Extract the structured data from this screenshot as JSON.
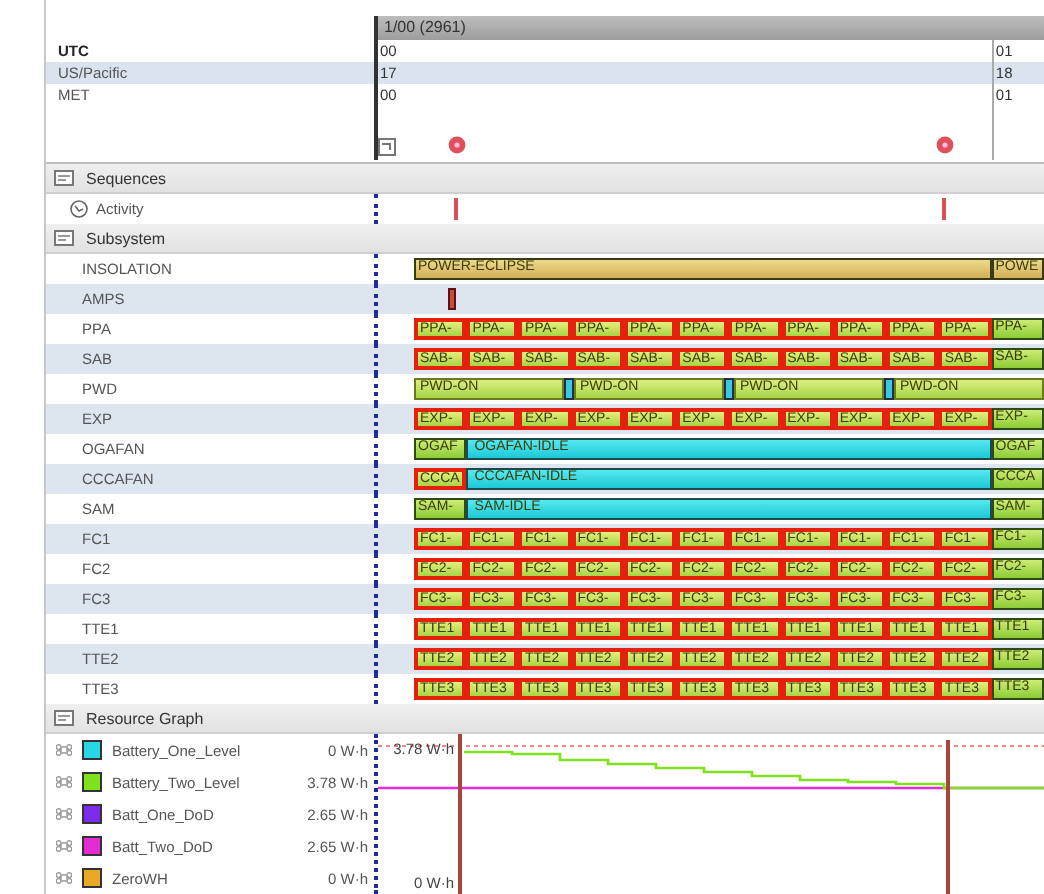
{
  "timeline": {
    "title": "1/00 (2961)",
    "zones": [
      {
        "name": "UTC",
        "primary": true,
        "selected": false,
        "start": "00",
        "end": "01"
      },
      {
        "name": "US/Pacific",
        "primary": false,
        "selected": true,
        "start": "17",
        "end": "18"
      },
      {
        "name": "MET",
        "primary": false,
        "selected": false,
        "start": "00",
        "end": "01"
      }
    ]
  },
  "sequences": {
    "title": "Sequences",
    "items": [
      {
        "name": "Activity"
      }
    ]
  },
  "subsystem": {
    "title": "Subsystem",
    "rows": [
      {
        "name": "INSOLATION",
        "segments": [
          {
            "label": "POWER-ECLIPSE",
            "kind": "eclipse"
          },
          {
            "label": "POWE",
            "kind": "edge"
          }
        ]
      },
      {
        "name": "AMPS",
        "segments": [
          {
            "kind": "spike"
          }
        ]
      },
      {
        "name": "PPA",
        "segments": [
          {
            "label": "PPA-",
            "kind": "active"
          },
          {
            "label": "PPA-",
            "kind": "active"
          },
          {
            "label": "PPA-",
            "kind": "active"
          },
          {
            "label": "PPA-",
            "kind": "active"
          },
          {
            "label": "PPA-",
            "kind": "active"
          },
          {
            "label": "PPA-",
            "kind": "active"
          },
          {
            "label": "PPA-",
            "kind": "active"
          },
          {
            "label": "PPA-",
            "kind": "active"
          },
          {
            "label": "PPA-",
            "kind": "active"
          },
          {
            "label": "PPA-",
            "kind": "active"
          },
          {
            "label": "PPA-",
            "kind": "active"
          },
          {
            "label": "PPA-",
            "kind": "plain"
          }
        ]
      },
      {
        "name": "SAB",
        "segments": [
          {
            "label": "SAB-",
            "kind": "active"
          },
          {
            "label": "SAB-",
            "kind": "active"
          },
          {
            "label": "SAB-",
            "kind": "active"
          },
          {
            "label": "SAB-",
            "kind": "active"
          },
          {
            "label": "SAB-",
            "kind": "active"
          },
          {
            "label": "SAB-",
            "kind": "active"
          },
          {
            "label": "SAB-",
            "kind": "active"
          },
          {
            "label": "SAB-",
            "kind": "active"
          },
          {
            "label": "SAB-",
            "kind": "active"
          },
          {
            "label": "SAB-",
            "kind": "active"
          },
          {
            "label": "SAB-",
            "kind": "active"
          },
          {
            "label": "SAB-",
            "kind": "plain"
          }
        ]
      },
      {
        "name": "PWD",
        "segments": [
          {
            "label": "PWD-ON",
            "kind": "on"
          },
          {
            "kind": "switch"
          },
          {
            "label": "PWD-ON",
            "kind": "on"
          },
          {
            "kind": "switch"
          },
          {
            "label": "PWD-ON",
            "kind": "on"
          },
          {
            "kind": "switch"
          },
          {
            "label": "PWD-ON",
            "kind": "on"
          }
        ]
      },
      {
        "name": "EXP",
        "segments": [
          {
            "label": "EXP-",
            "kind": "active"
          },
          {
            "label": "EXP-",
            "kind": "active"
          },
          {
            "label": "EXP-",
            "kind": "active"
          },
          {
            "label": "EXP-",
            "kind": "active"
          },
          {
            "label": "EXP-",
            "kind": "active"
          },
          {
            "label": "EXP-",
            "kind": "active"
          },
          {
            "label": "EXP-",
            "kind": "active"
          },
          {
            "label": "EXP-",
            "kind": "active"
          },
          {
            "label": "EXP-",
            "kind": "active"
          },
          {
            "label": "EXP-",
            "kind": "active"
          },
          {
            "label": "EXP-",
            "kind": "active"
          },
          {
            "label": "EXP-",
            "kind": "plain"
          }
        ]
      },
      {
        "name": "OGAFAN",
        "segments": [
          {
            "label": "OGAF",
            "kind": "plain"
          },
          {
            "label": "OGAFAN-IDLE",
            "kind": "idle"
          },
          {
            "label": "OGAF",
            "kind": "plain"
          }
        ]
      },
      {
        "name": "CCCAFAN",
        "segments": [
          {
            "label": "CCCA",
            "kind": "active"
          },
          {
            "label": "CCCAFAN-IDLE",
            "kind": "idle"
          },
          {
            "label": "CCCA",
            "kind": "plain"
          }
        ]
      },
      {
        "name": "SAM",
        "segments": [
          {
            "label": "SAM-",
            "kind": "plain"
          },
          {
            "label": "SAM-IDLE",
            "kind": "idle"
          },
          {
            "label": "SAM-",
            "kind": "plain"
          }
        ]
      },
      {
        "name": "FC1",
        "segments": [
          {
            "label": "FC1-",
            "kind": "active"
          },
          {
            "label": "FC1-",
            "kind": "active"
          },
          {
            "label": "FC1-",
            "kind": "active"
          },
          {
            "label": "FC1-",
            "kind": "active"
          },
          {
            "label": "FC1-",
            "kind": "active"
          },
          {
            "label": "FC1-",
            "kind": "active"
          },
          {
            "label": "FC1-",
            "kind": "active"
          },
          {
            "label": "FC1-",
            "kind": "active"
          },
          {
            "label": "FC1-",
            "kind": "active"
          },
          {
            "label": "FC1-",
            "kind": "active"
          },
          {
            "label": "FC1-",
            "kind": "active"
          },
          {
            "label": "FC1-",
            "kind": "plain"
          }
        ]
      },
      {
        "name": "FC2",
        "segments": [
          {
            "label": "FC2-",
            "kind": "active"
          },
          {
            "label": "FC2-",
            "kind": "active"
          },
          {
            "label": "FC2-",
            "kind": "active"
          },
          {
            "label": "FC2-",
            "kind": "active"
          },
          {
            "label": "FC2-",
            "kind": "active"
          },
          {
            "label": "FC2-",
            "kind": "active"
          },
          {
            "label": "FC2-",
            "kind": "active"
          },
          {
            "label": "FC2-",
            "kind": "active"
          },
          {
            "label": "FC2-",
            "kind": "active"
          },
          {
            "label": "FC2-",
            "kind": "active"
          },
          {
            "label": "FC2-",
            "kind": "active"
          },
          {
            "label": "FC2-",
            "kind": "plain"
          }
        ]
      },
      {
        "name": "FC3",
        "segments": [
          {
            "label": "FC3-",
            "kind": "active"
          },
          {
            "label": "FC3-",
            "kind": "active"
          },
          {
            "label": "FC3-",
            "kind": "active"
          },
          {
            "label": "FC3-",
            "kind": "active"
          },
          {
            "label": "FC3-",
            "kind": "active"
          },
          {
            "label": "FC3-",
            "kind": "active"
          },
          {
            "label": "FC3-",
            "kind": "active"
          },
          {
            "label": "FC3-",
            "kind": "active"
          },
          {
            "label": "FC3-",
            "kind": "active"
          },
          {
            "label": "FC3-",
            "kind": "active"
          },
          {
            "label": "FC3-",
            "kind": "active"
          },
          {
            "label": "FC3-",
            "kind": "plain"
          }
        ]
      },
      {
        "name": "TTE1",
        "segments": [
          {
            "label": "TTE1",
            "kind": "active"
          },
          {
            "label": "TTE1",
            "kind": "active"
          },
          {
            "label": "TTE1",
            "kind": "active"
          },
          {
            "label": "TTE1",
            "kind": "active"
          },
          {
            "label": "TTE1",
            "kind": "active"
          },
          {
            "label": "TTE1",
            "kind": "active"
          },
          {
            "label": "TTE1",
            "kind": "active"
          },
          {
            "label": "TTE1",
            "kind": "active"
          },
          {
            "label": "TTE1",
            "kind": "active"
          },
          {
            "label": "TTE1",
            "kind": "active"
          },
          {
            "label": "TTE1",
            "kind": "active"
          },
          {
            "label": "TTE1",
            "kind": "plain"
          }
        ]
      },
      {
        "name": "TTE2",
        "segments": [
          {
            "label": "TTE2",
            "kind": "active"
          },
          {
            "label": "TTE2",
            "kind": "active"
          },
          {
            "label": "TTE2",
            "kind": "active"
          },
          {
            "label": "TTE2",
            "kind": "active"
          },
          {
            "label": "TTE2",
            "kind": "active"
          },
          {
            "label": "TTE2",
            "kind": "active"
          },
          {
            "label": "TTE2",
            "kind": "active"
          },
          {
            "label": "TTE2",
            "kind": "active"
          },
          {
            "label": "TTE2",
            "kind": "active"
          },
          {
            "label": "TTE2",
            "kind": "active"
          },
          {
            "label": "TTE2",
            "kind": "active"
          },
          {
            "label": "TTE2",
            "kind": "plain"
          }
        ]
      },
      {
        "name": "TTE3",
        "segments": [
          {
            "label": "TTE3",
            "kind": "active"
          },
          {
            "label": "TTE3",
            "kind": "active"
          },
          {
            "label": "TTE3",
            "kind": "active"
          },
          {
            "label": "TTE3",
            "kind": "active"
          },
          {
            "label": "TTE3",
            "kind": "active"
          },
          {
            "label": "TTE3",
            "kind": "active"
          },
          {
            "label": "TTE3",
            "kind": "active"
          },
          {
            "label": "TTE3",
            "kind": "active"
          },
          {
            "label": "TTE3",
            "kind": "active"
          },
          {
            "label": "TTE3",
            "kind": "active"
          },
          {
            "label": "TTE3",
            "kind": "active"
          },
          {
            "label": "TTE3",
            "kind": "plain"
          }
        ]
      }
    ]
  },
  "resource_graph": {
    "title": "Resource Graph",
    "items": [
      {
        "name": "Battery_One_Level",
        "color": "#27d7e6",
        "value": "0 W·h"
      },
      {
        "name": "Battery_Two_Level",
        "color": "#7ee21c",
        "value": "3.78 W·h"
      },
      {
        "name": "Batt_One_DoD",
        "color": "#7d2bea",
        "value": "2.65 W·h"
      },
      {
        "name": "Batt_Two_DoD",
        "color": "#e52bd6",
        "value": "2.65 W·h"
      },
      {
        "name": "ZeroWH",
        "color": "#e9a926",
        "value": "0 W·h"
      }
    ],
    "graph": {
      "top_label": "3.78 W·h",
      "bottom_label": "0 W·h"
    }
  }
}
